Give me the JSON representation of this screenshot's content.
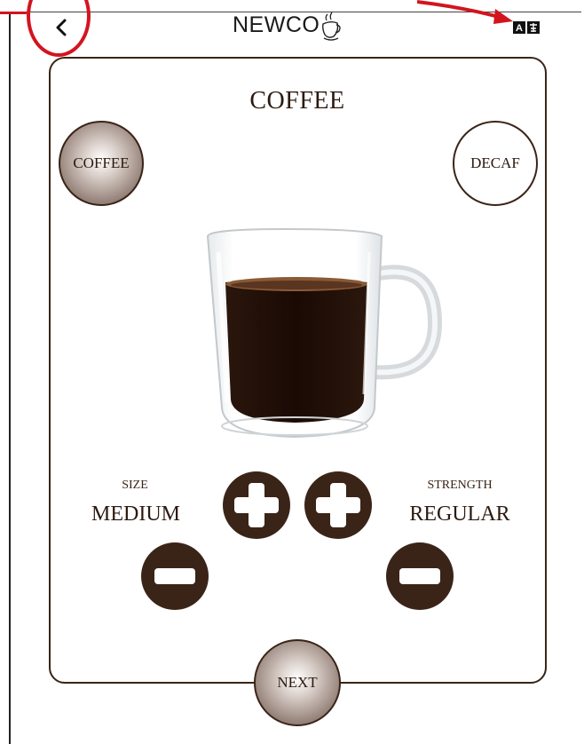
{
  "header": {
    "back_icon": "chevron-left-icon",
    "logo_text": "NEWCO",
    "translate_icon": "translate-icon"
  },
  "drink": {
    "title": "COFFEE",
    "options": [
      {
        "label": "COFFEE",
        "selected": true
      },
      {
        "label": "DECAF",
        "selected": false
      }
    ]
  },
  "size": {
    "label": "SIZE",
    "value": "MEDIUM"
  },
  "strength": {
    "label": "STRENGTH",
    "value": "REGULAR"
  },
  "footer": {
    "next_label": "NEXT"
  },
  "colors": {
    "brown": "#3a2418",
    "annotation_red": "#d3141e"
  }
}
